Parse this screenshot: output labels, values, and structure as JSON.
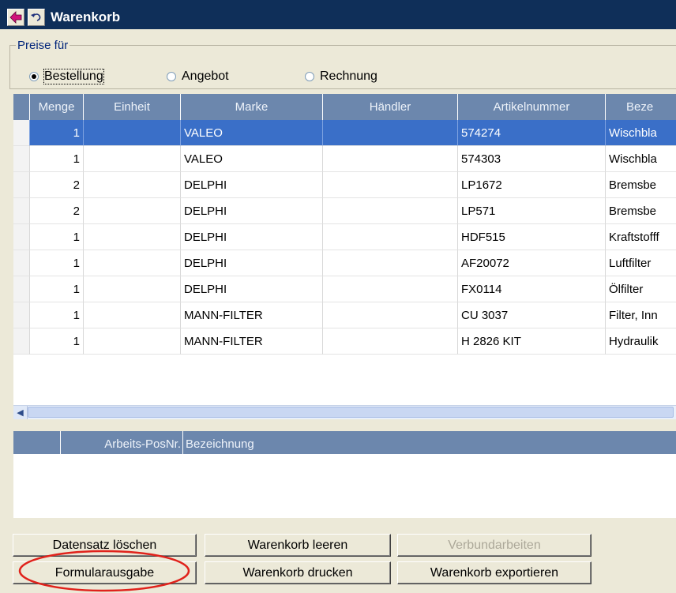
{
  "window": {
    "title": "Warenkorb",
    "back_icon": "back-arrow-icon",
    "undo_icon": "undo-icon"
  },
  "prices": {
    "legend": "Preise für",
    "options": [
      {
        "label": "Bestellung",
        "checked": true
      },
      {
        "label": "Angebot",
        "checked": false
      },
      {
        "label": "Rechnung",
        "checked": false
      }
    ]
  },
  "table": {
    "columns": [
      "Menge",
      "Einheit",
      "Marke",
      "Händler",
      "Artikelnummer",
      "Beze"
    ],
    "rows": [
      [
        "1",
        "",
        "VALEO",
        "",
        "574274",
        "Wischbla"
      ],
      [
        "1",
        "",
        "VALEO",
        "",
        "574303",
        "Wischbla"
      ],
      [
        "2",
        "",
        "DELPHI",
        "",
        "LP1672",
        "Bremsbe"
      ],
      [
        "2",
        "",
        "DELPHI",
        "",
        "LP571",
        "Bremsbe"
      ],
      [
        "1",
        "",
        "DELPHI",
        "",
        "HDF515",
        "Kraftstofff"
      ],
      [
        "1",
        "",
        "DELPHI",
        "",
        "AF20072",
        "Luftfilter"
      ],
      [
        "1",
        "",
        "DELPHI",
        "",
        "FX0114",
        "Ölfilter"
      ],
      [
        "1",
        "",
        "MANN-FILTER",
        "",
        "CU 3037",
        "Filter, Inn"
      ],
      [
        "1",
        "",
        "MANN-FILTER",
        "",
        "H 2826 KIT",
        "Hydraulik"
      ]
    ],
    "selected_row": 0
  },
  "work_table": {
    "columns": [
      "Arbeits-PosNr.",
      "Bezeichnung"
    ]
  },
  "buttons": {
    "delete_record": "Datensatz löschen",
    "clear_cart": "Warenkorb leeren",
    "compound_work": "Verbundarbeiten",
    "form_output": "Formularausgabe",
    "print_cart": "Warenkorb drucken",
    "export_cart": "Warenkorb exportieren"
  },
  "colors": {
    "title_bar": "#0f2f59",
    "header": "#6c87ad",
    "selection": "#3a6fc8",
    "annotation": "#e0221b"
  }
}
